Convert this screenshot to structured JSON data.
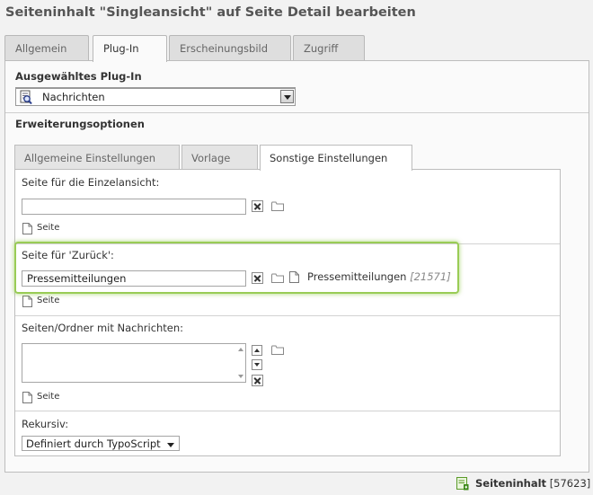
{
  "page_title": "Seiteninhalt \"Singleansicht\" auf Seite Detail bearbeiten",
  "main_tabs": [
    {
      "label": "Allgemein",
      "active": false
    },
    {
      "label": "Plug-In",
      "active": true
    },
    {
      "label": "Erscheinungsbild",
      "active": false
    },
    {
      "label": "Zugriff",
      "active": false
    }
  ],
  "plugin": {
    "label": "Ausgewähltes Plug-In",
    "selected": "Nachrichten",
    "icon": "news-plugin-icon"
  },
  "extension_options": {
    "label": "Erweiterungsoptionen",
    "tabs": [
      {
        "label": "Allgemeine Einstellungen",
        "active": false
      },
      {
        "label": "Vorlage",
        "active": false
      },
      {
        "label": "Sonstige Einstellungen",
        "active": true
      }
    ]
  },
  "fields": {
    "single_view": {
      "label": "Seite für die Einzelansicht:",
      "value": "",
      "link_label": "Seite"
    },
    "back_page": {
      "label": "Seite für 'Zurück':",
      "value": "Pressemitteilungen",
      "record_title": "Pressemitteilungen",
      "record_id": "[21571]",
      "link_label": "Seite",
      "highlight_color": "#99cc55"
    },
    "news_folders": {
      "label": "Seiten/Ordner mit Nachrichten:",
      "link_label": "Seite"
    },
    "recursive": {
      "label": "Rekursiv:",
      "selected": "Definiert durch TypoScript"
    }
  },
  "footer": {
    "label": "Seiteninhalt",
    "id": "[57623]",
    "icon": "content-element-icon"
  }
}
